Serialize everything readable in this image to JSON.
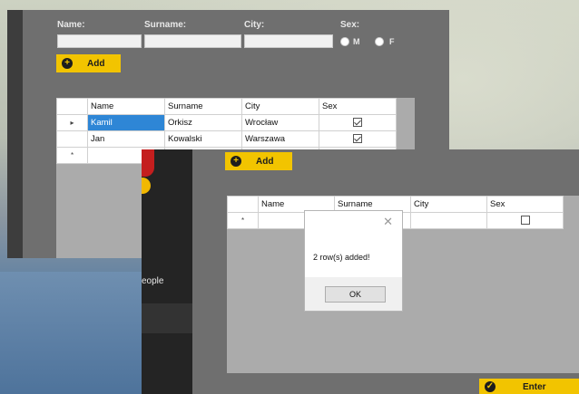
{
  "window1": {
    "form": {
      "name_label": "Name:",
      "surname_label": "Surname:",
      "city_label": "City:",
      "sex_label": "Sex:",
      "name_value": "",
      "surname_value": "",
      "city_value": "",
      "sex_option_m": "M",
      "sex_option_f": "F",
      "add_button": "Add",
      "add_icon": "plus-circle-icon"
    },
    "grid": {
      "columns": [
        "Name",
        "Surname",
        "City",
        "Sex"
      ],
      "rows": [
        {
          "marker": "▸",
          "name": "Kamil",
          "surname": "Orkisz",
          "city": "Wrocław",
          "sex_checked": true
        },
        {
          "marker": "",
          "name": "Jan",
          "surname": "Kowalski",
          "city": "Warszawa",
          "sex_checked": true
        }
      ],
      "new_row_marker": "*"
    }
  },
  "window2": {
    "side_label": "eople",
    "add_button": "Add",
    "grid": {
      "columns": [
        "Name",
        "Surname",
        "City",
        "Sex"
      ],
      "new_row_marker": "*"
    },
    "enter_button": "Enter"
  },
  "dialog": {
    "message": "2 row(s) added!",
    "ok_button": "OK",
    "close_glyph": "✕"
  },
  "colors": {
    "accent": "#f2c400",
    "panel": "#6f6f6f",
    "selection": "#2e86d6"
  }
}
